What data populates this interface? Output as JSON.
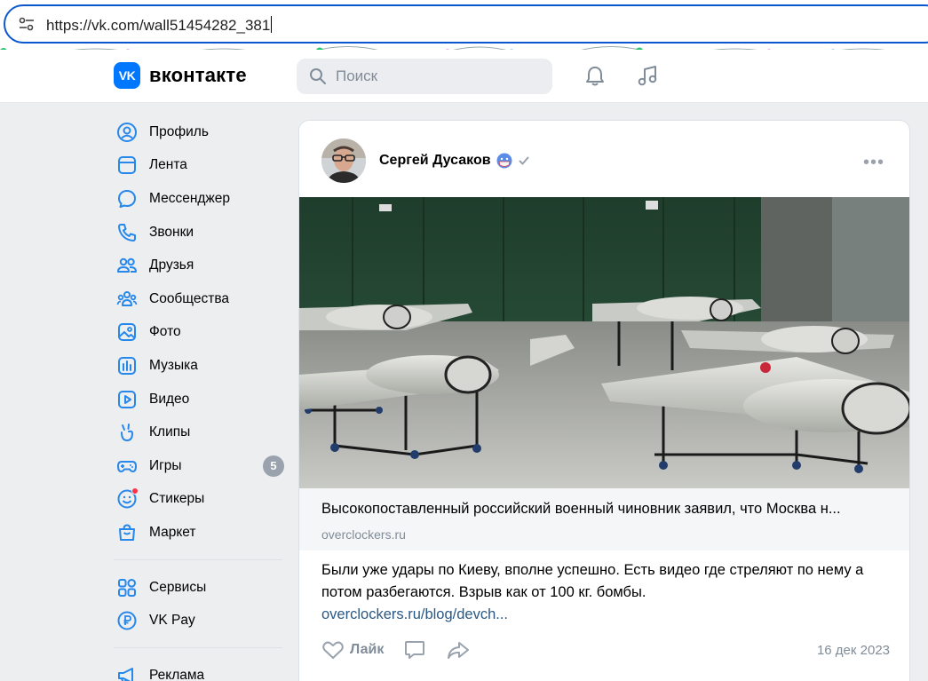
{
  "browser": {
    "url": "https://vk.com/wall51454282_381"
  },
  "header": {
    "logo_text": "вконтакте",
    "logo_mark": "VK",
    "search_placeholder": "Поиск"
  },
  "sidebar": {
    "items": [
      {
        "label": "Профиль",
        "icon": "profile-icon"
      },
      {
        "label": "Лента",
        "icon": "feed-icon"
      },
      {
        "label": "Мессенджер",
        "icon": "messenger-icon"
      },
      {
        "label": "Звонки",
        "icon": "phone-icon"
      },
      {
        "label": "Друзья",
        "icon": "friends-icon"
      },
      {
        "label": "Сообщества",
        "icon": "communities-icon"
      },
      {
        "label": "Фото",
        "icon": "photo-icon"
      },
      {
        "label": "Музыка",
        "icon": "music-icon"
      },
      {
        "label": "Видео",
        "icon": "video-icon"
      },
      {
        "label": "Клипы",
        "icon": "clips-icon"
      },
      {
        "label": "Игры",
        "icon": "games-icon",
        "badge": "5"
      },
      {
        "label": "Стикеры",
        "icon": "stickers-icon"
      },
      {
        "label": "Маркет",
        "icon": "market-icon"
      }
    ],
    "services": [
      {
        "label": "Сервисы",
        "icon": "services-icon"
      },
      {
        "label": "VK Pay",
        "icon": "vkpay-icon"
      }
    ],
    "ads": [
      {
        "label": "Реклама",
        "icon": "ads-icon"
      }
    ]
  },
  "post": {
    "author": "Сергей Дусаков",
    "link_title": "Высокопоставленный российский военный чиновник заявил, что Москва н...",
    "link_domain": "overclockers.ru",
    "text": "Были уже удары по Киеву, вполне успешно. Есть видео где стреляют по нему а потом разбегаются. Взрыв как от 100 кг. бомбы.",
    "text_link": "overclockers.ru/blog/devch...",
    "like_label": "Лайк",
    "date": "16 дек 2023"
  },
  "colors": {
    "accent": "#0077ff",
    "link": "#2a5885",
    "muted": "#818c99",
    "icon": "#2688eb"
  }
}
